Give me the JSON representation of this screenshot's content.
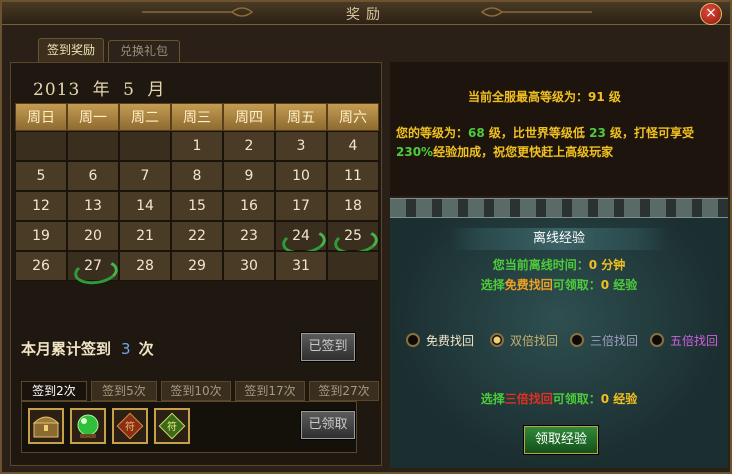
{
  "window": {
    "title": "奖励",
    "close_symbol": "×"
  },
  "tabs": [
    {
      "label": "签到奖励",
      "active": true
    },
    {
      "label": "兑换礼包",
      "active": false
    }
  ],
  "calendar": {
    "year": "2013",
    "year_unit": "年",
    "month": "5",
    "month_unit": "月",
    "weekdays": [
      "周日",
      "周一",
      "周二",
      "周三",
      "周四",
      "周五",
      "周六"
    ],
    "leading_blanks": 3,
    "days_in_month": 31,
    "signed_days": [
      24,
      25,
      27
    ]
  },
  "summary": {
    "label": "本月累计签到",
    "count": "3",
    "unit": "次"
  },
  "sign_button": "已签到",
  "reward_tabs": [
    {
      "label": "签到2次",
      "active": true
    },
    {
      "label": "签到5次",
      "active": false
    },
    {
      "label": "签到10次",
      "active": false
    },
    {
      "label": "签到17次",
      "active": false
    },
    {
      "label": "签到27次",
      "active": false
    }
  ],
  "reward_items": [
    "treasure-chest-icon",
    "green-orb-icon",
    "scroll-red-icon",
    "scroll-green-icon"
  ],
  "claim_button": "已领取",
  "server_info": {
    "prefix": "当前全服最高等级为：",
    "level": "91",
    "unit": "级"
  },
  "player_info": {
    "p1": "您的等级为：",
    "level": "68",
    "p2": "级，比世界等级低",
    "diff": "23",
    "p3": "级，打怪可享受",
    "bonus": "230%",
    "p4": "经验加成，祝您更快赶上高级玩家"
  },
  "offline": {
    "title": "离线经验",
    "time_prefix": "您当前离线时间：",
    "time_value": "0",
    "time_unit": "分钟",
    "free_prefix": "选择",
    "free_mode": "免费找回",
    "free_mid": "可领取：",
    "free_value": "0",
    "free_unit": "经验",
    "options": [
      {
        "label": "免费找回",
        "color": "#f2e7cc",
        "selected": false
      },
      {
        "label": "双倍找回",
        "color": "#c8b070",
        "selected": true
      },
      {
        "label": "三倍找回",
        "color": "#a0a0c0",
        "selected": false
      },
      {
        "label": "五倍找回",
        "color": "#d060e0",
        "selected": false
      }
    ],
    "sel_prefix": "选择",
    "sel_mode": "三倍找回",
    "sel_mid": "可领取：",
    "sel_value": "0",
    "sel_unit": "经验",
    "button": "领取经验"
  }
}
